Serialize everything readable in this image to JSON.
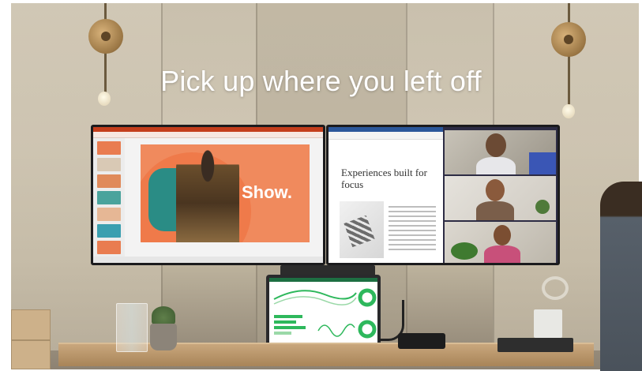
{
  "headline": "Pick up where you left off",
  "slide": {
    "word": "Show."
  },
  "document": {
    "title": "Experiences built for focus"
  },
  "colors": {
    "powerpoint_accent": "#c43e1c",
    "word_accent": "#2b579a",
    "excel_accent": "#1d6f42",
    "slide_background": "#f08a5d",
    "headline_text": "#ffffff"
  }
}
